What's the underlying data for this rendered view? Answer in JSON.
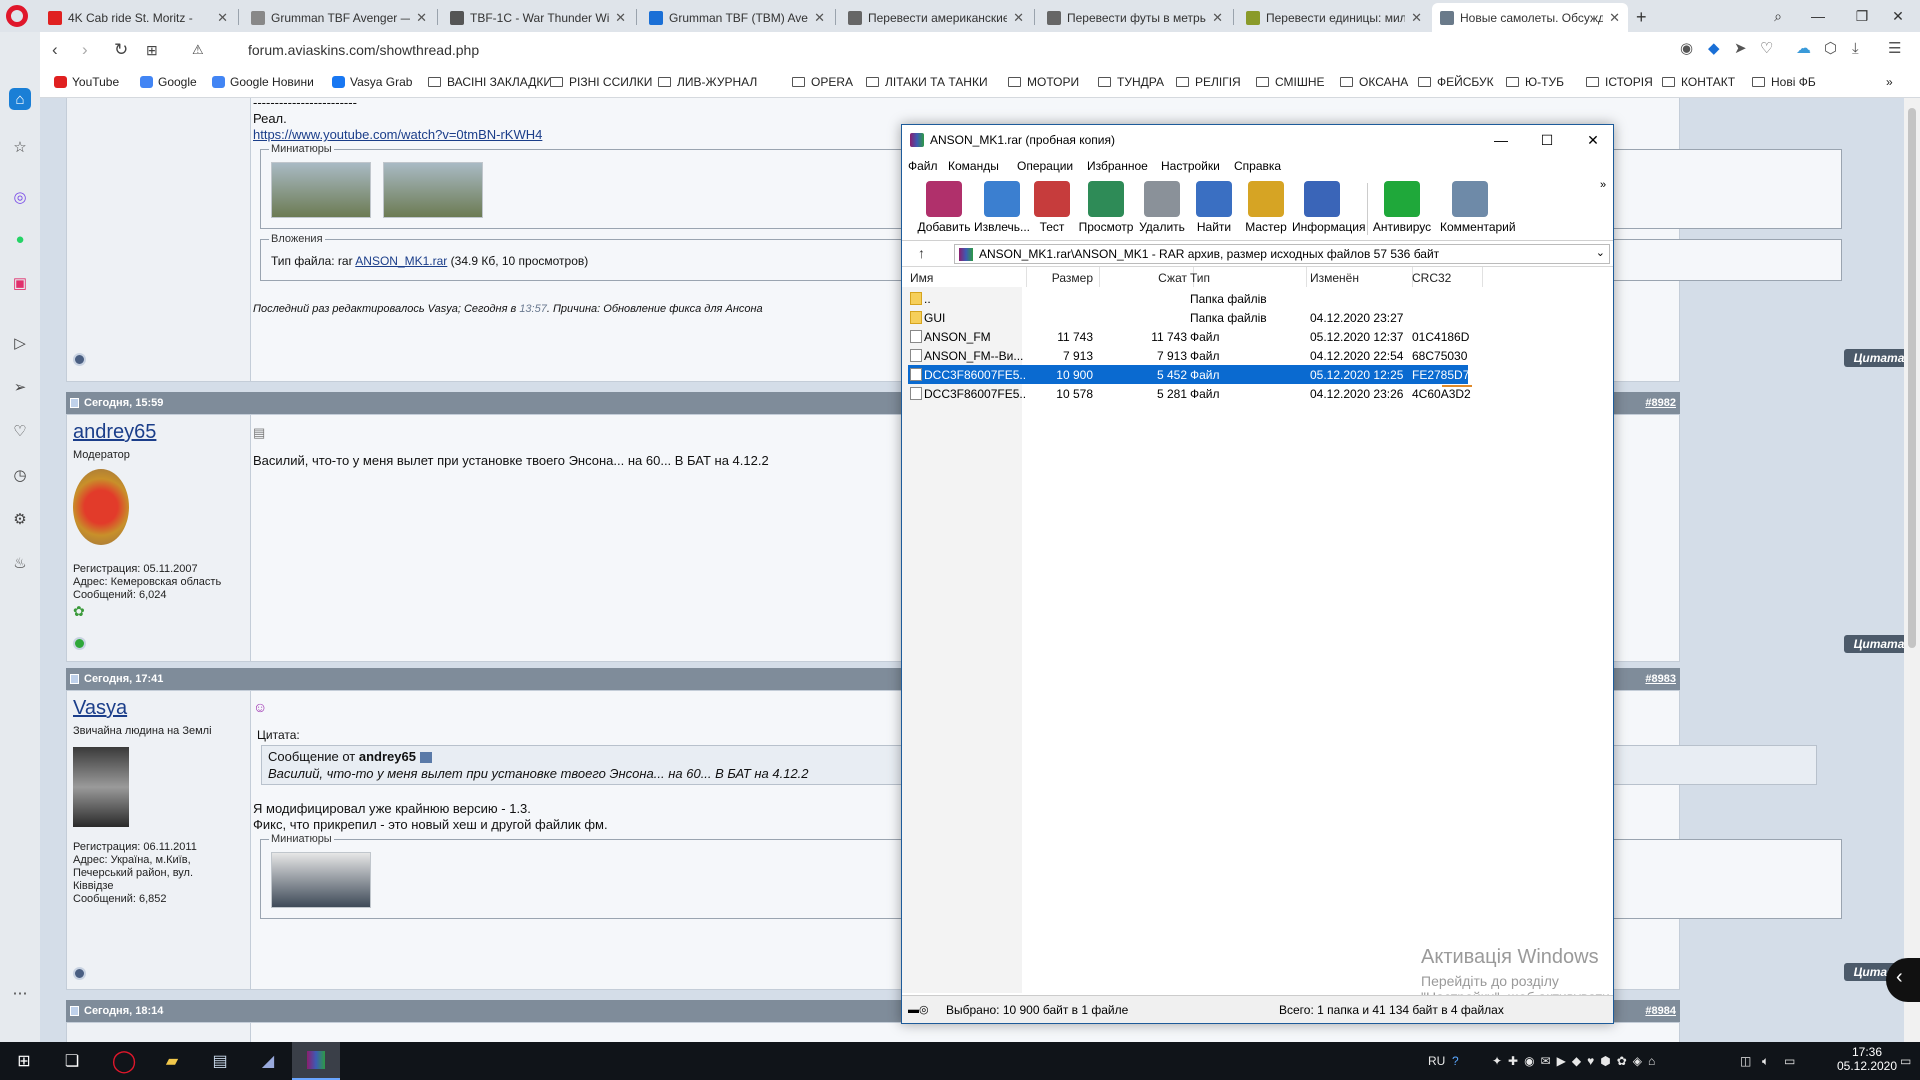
{
  "browser": {
    "tabs": [
      {
        "title": "4K Cab ride St. Moritz -",
        "fav": "#e02020"
      },
      {
        "title": "Grumman TBF Avenger —",
        "fav": "#888"
      },
      {
        "title": "TBF-1C - War Thunder Wiki",
        "fav": "#555"
      },
      {
        "title": "Grumman TBF (TBM) Aven",
        "fav": "#1a6fd6"
      },
      {
        "title": "Перевести американские",
        "fav": "#666"
      },
      {
        "title": "Перевести футы в метры",
        "fav": "#666"
      },
      {
        "title": "Перевести единицы: мил",
        "fav": "#8a9a2a"
      },
      {
        "title": "Новые самолеты. Обсужд",
        "fav": "#6a7a8a"
      }
    ],
    "url": "forum.aviaskins.com/showthread.php",
    "bookmarks": [
      "YouTube",
      "Google",
      "Google Новини",
      "Vasya Grab",
      "ВАСІНІ ЗАКЛАДКИ",
      "РІЗНІ ССИЛКИ",
      "ЛИВ-ЖУРНАЛ",
      "OPERA",
      "ЛІТАКИ ТА ТАНКИ",
      "МОТОРИ",
      "ТУНДРА",
      "РЕЛІГІЯ",
      "СМІШНЕ",
      "ОКСАНА",
      "ФЕЙСБУК",
      "Ю-ТУБ",
      "ІСТОРІЯ",
      "КОНТАКТ",
      "Нові ФБ"
    ]
  },
  "forum": {
    "top_post": {
      "dashes": "------------------------",
      "real": "Реал.",
      "link": "https://www.youtube.com/watch?v=0tmBN-rKWH4",
      "thumbs_label": "Миниатюры",
      "attach_label": "Вложения",
      "attach_prefix": "Тип файла: rar",
      "attach_name": "ANSON_MK1.rar",
      "attach_info": "(34.9 Кб, 10 просмотров)",
      "edited": "Последний раз редактировалось Vasya; Сегодня в",
      "edited_time": "13:57",
      "edited_reason": ". Причина: Обновление фикса для Ансона"
    },
    "posts": [
      {
        "date": "Сегодня, 15:59",
        "num": "#8982",
        "user": "andrey65",
        "role": "Модератор",
        "reg": "Регистрация: 05.11.2007",
        "addr": "Адрес: Кемеровская область",
        "msgs": "Сообщений: 6,024",
        "text": "Василий, что-то у меня вылет при установке твоего Энсона... на 60... В БАТ на 4.12.2"
      },
      {
        "date": "Сегодня, 17:41",
        "num": "#8983",
        "user": "Vasya",
        "role": "Звичайна людина на Землі",
        "reg": "Регистрация: 06.11.2011",
        "addr": "Адрес: Україна, м.Київ, Печерський район, вул. Ківвідзе",
        "msgs": "Сообщений: 6,852",
        "quote_label": "Цитата:",
        "quote_from": "Сообщение от",
        "quote_user": "andrey65",
        "quote_text": "Василий, что-то у меня вылет при установке твоего Энсона... на 60... В БАТ на 4.12.2",
        "text1": "Я модифицировал уже крайнюю версию - 1.3.",
        "text2": "Фикс, что прикрепил - это новый хеш и другой файлик фм.",
        "thumbs_label": "Миниатюры"
      },
      {
        "date": "Сегодня, 18:14",
        "num": "#8984"
      }
    ],
    "quote_button": "Цитата"
  },
  "winrar": {
    "title": "ANSON_MK1.rar (пробная копия)",
    "menu": [
      "Файл",
      "Команды",
      "Операции",
      "Избранное",
      "Настройки",
      "Справка"
    ],
    "toolbar": [
      {
        "label": "Добавить",
        "color": "#b0306b"
      },
      {
        "label": "Извлечь...",
        "color": "#3b7fd0"
      },
      {
        "label": "Тест",
        "color": "#c63c3c"
      },
      {
        "label": "Просмотр",
        "color": "#2e8b57"
      },
      {
        "label": "Удалить",
        "color": "#8a9199"
      },
      {
        "label": "Найти",
        "color": "#3a6fc2"
      },
      {
        "label": "Мастер",
        "color": "#d6a424"
      },
      {
        "label": "Информация",
        "color": "#3a65b8"
      },
      {
        "label": "Антивирус",
        "color": "#1fa83a"
      },
      {
        "label": "Комментарий",
        "color": "#6e8aa8"
      }
    ],
    "path": "ANSON_MK1.rar\\ANSON_MK1 - RAR архив, размер исходных файлов 57 536 байт",
    "columns": [
      "Имя",
      "Размер",
      "Сжат",
      "Тип",
      "Изменён",
      "CRC32"
    ],
    "rows": [
      {
        "name": "..",
        "size": "",
        "packed": "",
        "type": "Папка файлів",
        "mod": "",
        "crc": "",
        "folder": true
      },
      {
        "name": "GUI",
        "size": "",
        "packed": "",
        "type": "Папка файлів",
        "mod": "04.12.2020 23:27",
        "crc": "",
        "folder": true
      },
      {
        "name": "ANSON_FM",
        "size": "11 743",
        "packed": "11 743",
        "type": "Файл",
        "mod": "05.12.2020 12:37",
        "crc": "01C4186D",
        "folder": false
      },
      {
        "name": "ANSON_FM--Ви...",
        "size": "7 913",
        "packed": "7 913",
        "type": "Файл",
        "mod": "04.12.2020 22:54",
        "crc": "68C75030",
        "folder": false
      },
      {
        "name": "DCC3F86007FE5...",
        "size": "10 900",
        "packed": "5 452",
        "type": "Файл",
        "mod": "05.12.2020 12:25",
        "crc": "FE2785D7",
        "folder": false,
        "selected": true
      },
      {
        "name": "DCC3F86007FE5...",
        "size": "10 578",
        "packed": "5 281",
        "type": "Файл",
        "mod": "04.12.2020 23:26",
        "crc": "4C60A3D2",
        "folder": false
      }
    ],
    "status_left": "Выбрано: 10 900 байт в 1 файле",
    "status_right": "Всего: 1 папка и 41 134 байт в 4 файлах"
  },
  "activation": {
    "title": "Активація Windows",
    "sub": "Перейдіть до розділу \"Настройки\", щоб активувати Wi"
  },
  "taskbar": {
    "lang": "RU",
    "time": "17:36",
    "date": "05.12.2020"
  }
}
